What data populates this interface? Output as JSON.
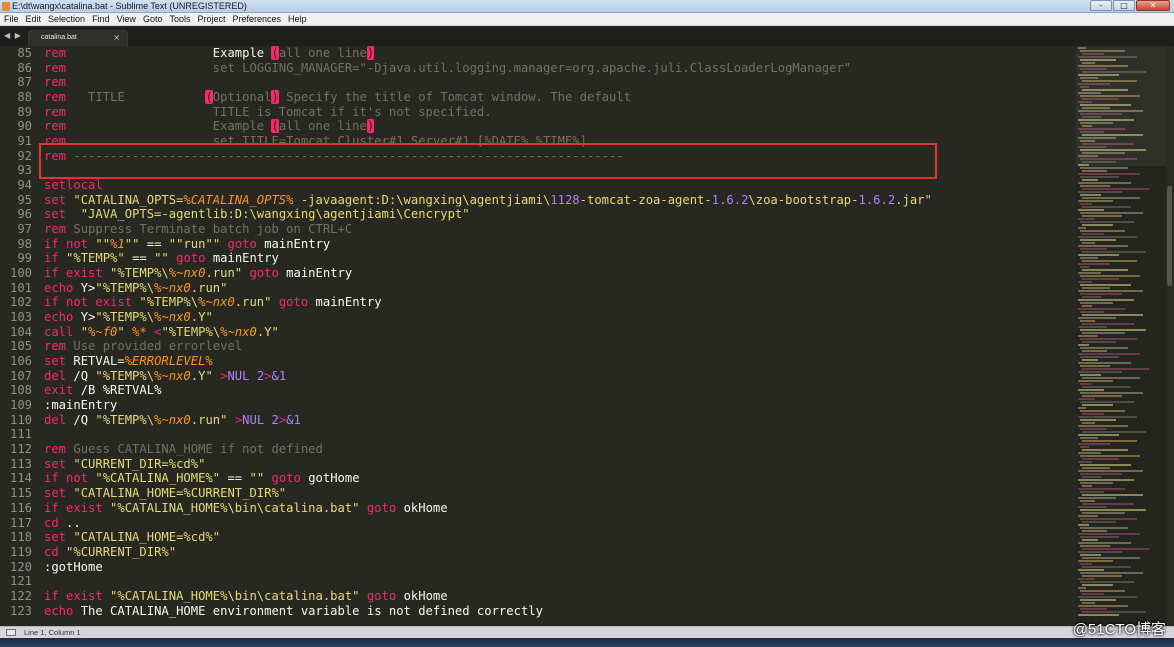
{
  "window": {
    "title": "E:\\dt\\wangx\\catalina.bat - Sublime Text (UNREGISTERED)",
    "minimize": "–",
    "maximize": "□",
    "close": "✕"
  },
  "menu": [
    "File",
    "Edit",
    "Selection",
    "Find",
    "View",
    "Goto",
    "Tools",
    "Project",
    "Preferences",
    "Help"
  ],
  "tabs": {
    "nav": "◀ ▶",
    "active": "catalina.bat",
    "close": "×"
  },
  "status": {
    "text": "Line 1, Column 1"
  },
  "watermark": "@51CTO博客",
  "colors": {
    "background": "#272822",
    "keyword": "#f92672",
    "string": "#e6db74",
    "comment": "#75715e",
    "variable": "#fd971f",
    "highlight_box": "#e1342c"
  },
  "lines": [
    {
      "n": "85",
      "t": [
        [
          "kw",
          "rem"
        ],
        [
          "w",
          "                    Example "
        ],
        [
          "brk",
          "("
        ],
        [
          "cmt",
          "all one line"
        ],
        [
          "brk",
          ")"
        ]
      ]
    },
    {
      "n": "86",
      "t": [
        [
          "kw",
          "rem"
        ],
        [
          "cmt",
          "                    set LOGGING_MANAGER=\"-Djava.util.logging.manager=org.apache.juli.ClassLoaderLogManager\""
        ]
      ]
    },
    {
      "n": "87",
      "t": [
        [
          "kw",
          "rem"
        ]
      ]
    },
    {
      "n": "88",
      "t": [
        [
          "kw",
          "rem"
        ],
        [
          "cmt",
          "   TITLE           "
        ],
        [
          "brk",
          "("
        ],
        [
          "cmt",
          "Optional"
        ],
        [
          "brk",
          ")"
        ],
        [
          "cmt",
          " Specify the title of Tomcat window. The default"
        ]
      ]
    },
    {
      "n": "89",
      "t": [
        [
          "kw",
          "rem"
        ],
        [
          "cmt",
          "                    TITLE is Tomcat if it's not specified."
        ]
      ]
    },
    {
      "n": "90",
      "t": [
        [
          "kw",
          "rem"
        ],
        [
          "cmt",
          "                    Example "
        ],
        [
          "brk",
          "("
        ],
        [
          "cmt",
          "all one line"
        ],
        [
          "brk",
          ")"
        ]
      ]
    },
    {
      "n": "91",
      "t": [
        [
          "kw",
          "rem"
        ],
        [
          "cmt",
          "                    set TITLE=Tomcat.Cluster#1.Server#1 [%DATE% %TIME%]"
        ]
      ]
    },
    {
      "n": "92",
      "t": [
        [
          "kw",
          "rem"
        ],
        [
          "cmt",
          " ---------------------------------------------------------------------------"
        ]
      ]
    },
    {
      "n": "93",
      "t": []
    },
    {
      "n": "94",
      "t": [
        [
          "kw",
          "setlocal"
        ]
      ]
    },
    {
      "n": "95",
      "t": [
        [
          "kw",
          "set"
        ],
        [
          "w",
          " "
        ],
        [
          "str",
          "\"CATALINA_OPTS="
        ],
        [
          "var",
          "%CATALINA_OPTS%"
        ],
        [
          "str",
          " -javaagent:D:\\wangxing\\agentjiami\\"
        ],
        [
          "num",
          "1128"
        ],
        [
          "str",
          "-tomcat-zoa-agent-"
        ],
        [
          "num",
          "1.6.2"
        ],
        [
          "str",
          "\\zoa-bootstrap-"
        ],
        [
          "num",
          "1.6.2"
        ],
        [
          "str",
          ".jar\""
        ]
      ]
    },
    {
      "n": "96",
      "t": [
        [
          "kw",
          "set"
        ],
        [
          "w",
          "  "
        ],
        [
          "str",
          "\"JAVA_OPTS=-agentlib:D:\\wangxing\\agentjiami\\Cencrypt\""
        ]
      ]
    },
    {
      "n": "97",
      "t": [
        [
          "kw",
          "rem"
        ],
        [
          "cmt",
          " Suppress Terminate batch job on CTRL+C"
        ]
      ]
    },
    {
      "n": "98",
      "t": [
        [
          "kw",
          "if not"
        ],
        [
          "w",
          " "
        ],
        [
          "str",
          "\"\""
        ],
        [
          "var",
          "%1"
        ],
        [
          "str",
          "\"\""
        ],
        [
          "w",
          " == "
        ],
        [
          "str",
          "\"\"run\"\""
        ],
        [
          "w",
          " "
        ],
        [
          "kw",
          "goto"
        ],
        [
          "w",
          " mainEntry"
        ]
      ]
    },
    {
      "n": "99",
      "t": [
        [
          "kw",
          "if"
        ],
        [
          "w",
          " "
        ],
        [
          "str",
          "\"%TEMP%\""
        ],
        [
          "w",
          " == "
        ],
        [
          "str",
          "\"\""
        ],
        [
          "w",
          " "
        ],
        [
          "kw",
          "goto"
        ],
        [
          "w",
          " mainEntry"
        ]
      ]
    },
    {
      "n": "100",
      "t": [
        [
          "kw",
          "if exist"
        ],
        [
          "w",
          " "
        ],
        [
          "str",
          "\"%TEMP%\\"
        ],
        [
          "var",
          "%~nx0"
        ],
        [
          "str",
          ".run\""
        ],
        [
          "w",
          " "
        ],
        [
          "kw",
          "goto"
        ],
        [
          "w",
          " mainEntry"
        ]
      ]
    },
    {
      "n": "101",
      "t": [
        [
          "kw",
          "echo"
        ],
        [
          "w",
          " Y>"
        ],
        [
          "str",
          "\"%TEMP%\\"
        ],
        [
          "var",
          "%~nx0"
        ],
        [
          "str",
          ".run\""
        ]
      ]
    },
    {
      "n": "102",
      "t": [
        [
          "kw",
          "if not exist"
        ],
        [
          "w",
          " "
        ],
        [
          "str",
          "\"%TEMP%\\"
        ],
        [
          "var",
          "%~nx0"
        ],
        [
          "str",
          ".run\""
        ],
        [
          "w",
          " "
        ],
        [
          "kw",
          "goto"
        ],
        [
          "w",
          " mainEntry"
        ]
      ]
    },
    {
      "n": "103",
      "t": [
        [
          "kw",
          "echo"
        ],
        [
          "w",
          " Y>"
        ],
        [
          "str",
          "\"%TEMP%\\"
        ],
        [
          "var",
          "%~nx0"
        ],
        [
          "str",
          ".Y\""
        ]
      ]
    },
    {
      "n": "104",
      "t": [
        [
          "kw",
          "call"
        ],
        [
          "w",
          " "
        ],
        [
          "str",
          "\""
        ],
        [
          "var",
          "%~f0"
        ],
        [
          "str",
          "\""
        ],
        [
          "w",
          " "
        ],
        [
          "var",
          "%*"
        ],
        [
          "w",
          " "
        ],
        [
          "kw",
          "<"
        ],
        [
          "str",
          "\"%TEMP%\\"
        ],
        [
          "var",
          "%~nx0"
        ],
        [
          "str",
          ".Y\""
        ]
      ]
    },
    {
      "n": "105",
      "t": [
        [
          "kw",
          "rem"
        ],
        [
          "cmt",
          " Use provided errorlevel"
        ]
      ]
    },
    {
      "n": "106",
      "t": [
        [
          "kw",
          "set"
        ],
        [
          "w",
          " RETVAL="
        ],
        [
          "var",
          "%ERRORLEVEL%"
        ]
      ]
    },
    {
      "n": "107",
      "t": [
        [
          "kw",
          "del"
        ],
        [
          "w",
          " /Q "
        ],
        [
          "str",
          "\"%TEMP%\\"
        ],
        [
          "var",
          "%~nx0"
        ],
        [
          "str",
          ".Y\""
        ],
        [
          "w",
          " "
        ],
        [
          "kw",
          ">"
        ],
        [
          "num",
          "NUL 2"
        ],
        [
          "kw",
          ">"
        ],
        [
          "num",
          "&1"
        ]
      ]
    },
    {
      "n": "108",
      "t": [
        [
          "kw",
          "exit"
        ],
        [
          "w",
          " /B %RETVAL%"
        ]
      ]
    },
    {
      "n": "109",
      "t": [
        [
          "w",
          ":mainEntry"
        ]
      ]
    },
    {
      "n": "110",
      "t": [
        [
          "kw",
          "del"
        ],
        [
          "w",
          " /Q "
        ],
        [
          "str",
          "\"%TEMP%\\"
        ],
        [
          "var",
          "%~nx0"
        ],
        [
          "str",
          ".run\""
        ],
        [
          "w",
          " "
        ],
        [
          "kw",
          ">"
        ],
        [
          "num",
          "NUL 2"
        ],
        [
          "kw",
          ">"
        ],
        [
          "num",
          "&1"
        ]
      ]
    },
    {
      "n": "111",
      "t": []
    },
    {
      "n": "112",
      "t": [
        [
          "kw",
          "rem"
        ],
        [
          "cmt",
          " Guess CATALINA_HOME if not defined"
        ]
      ]
    },
    {
      "n": "113",
      "t": [
        [
          "kw",
          "set"
        ],
        [
          "w",
          " "
        ],
        [
          "str",
          "\"CURRENT_DIR=%cd%\""
        ]
      ]
    },
    {
      "n": "114",
      "t": [
        [
          "kw",
          "if not"
        ],
        [
          "w",
          " "
        ],
        [
          "str",
          "\"%CATALINA_HOME%\""
        ],
        [
          "w",
          " == "
        ],
        [
          "str",
          "\"\""
        ],
        [
          "w",
          " "
        ],
        [
          "kw",
          "goto"
        ],
        [
          "w",
          " gotHome"
        ]
      ]
    },
    {
      "n": "115",
      "t": [
        [
          "kw",
          "set"
        ],
        [
          "w",
          " "
        ],
        [
          "str",
          "\"CATALINA_HOME=%CURRENT_DIR%\""
        ]
      ]
    },
    {
      "n": "116",
      "t": [
        [
          "kw",
          "if exist"
        ],
        [
          "w",
          " "
        ],
        [
          "str",
          "\"%CATALINA_HOME%\\bin\\catalina.bat\""
        ],
        [
          "w",
          " "
        ],
        [
          "kw",
          "goto"
        ],
        [
          "w",
          " okHome"
        ]
      ]
    },
    {
      "n": "117",
      "t": [
        [
          "kw",
          "cd"
        ],
        [
          "w",
          " .."
        ]
      ]
    },
    {
      "n": "118",
      "t": [
        [
          "kw",
          "set"
        ],
        [
          "w",
          " "
        ],
        [
          "str",
          "\"CATALINA_HOME=%cd%\""
        ]
      ]
    },
    {
      "n": "119",
      "t": [
        [
          "kw",
          "cd"
        ],
        [
          "w",
          " "
        ],
        [
          "str",
          "\"%CURRENT_DIR%\""
        ]
      ]
    },
    {
      "n": "120",
      "t": [
        [
          "w",
          ":gotHome"
        ]
      ]
    },
    {
      "n": "121",
      "t": []
    },
    {
      "n": "122",
      "t": [
        [
          "kw",
          "if exist"
        ],
        [
          "w",
          " "
        ],
        [
          "str",
          "\"%CATALINA_HOME%\\bin\\catalina.bat\""
        ],
        [
          "w",
          " "
        ],
        [
          "kw",
          "goto"
        ],
        [
          "w",
          " okHome"
        ]
      ]
    },
    {
      "n": "123",
      "t": [
        [
          "kw",
          "echo"
        ],
        [
          "w",
          " The CATALINA_HOME environment variable is not defined correctly"
        ]
      ]
    }
  ]
}
